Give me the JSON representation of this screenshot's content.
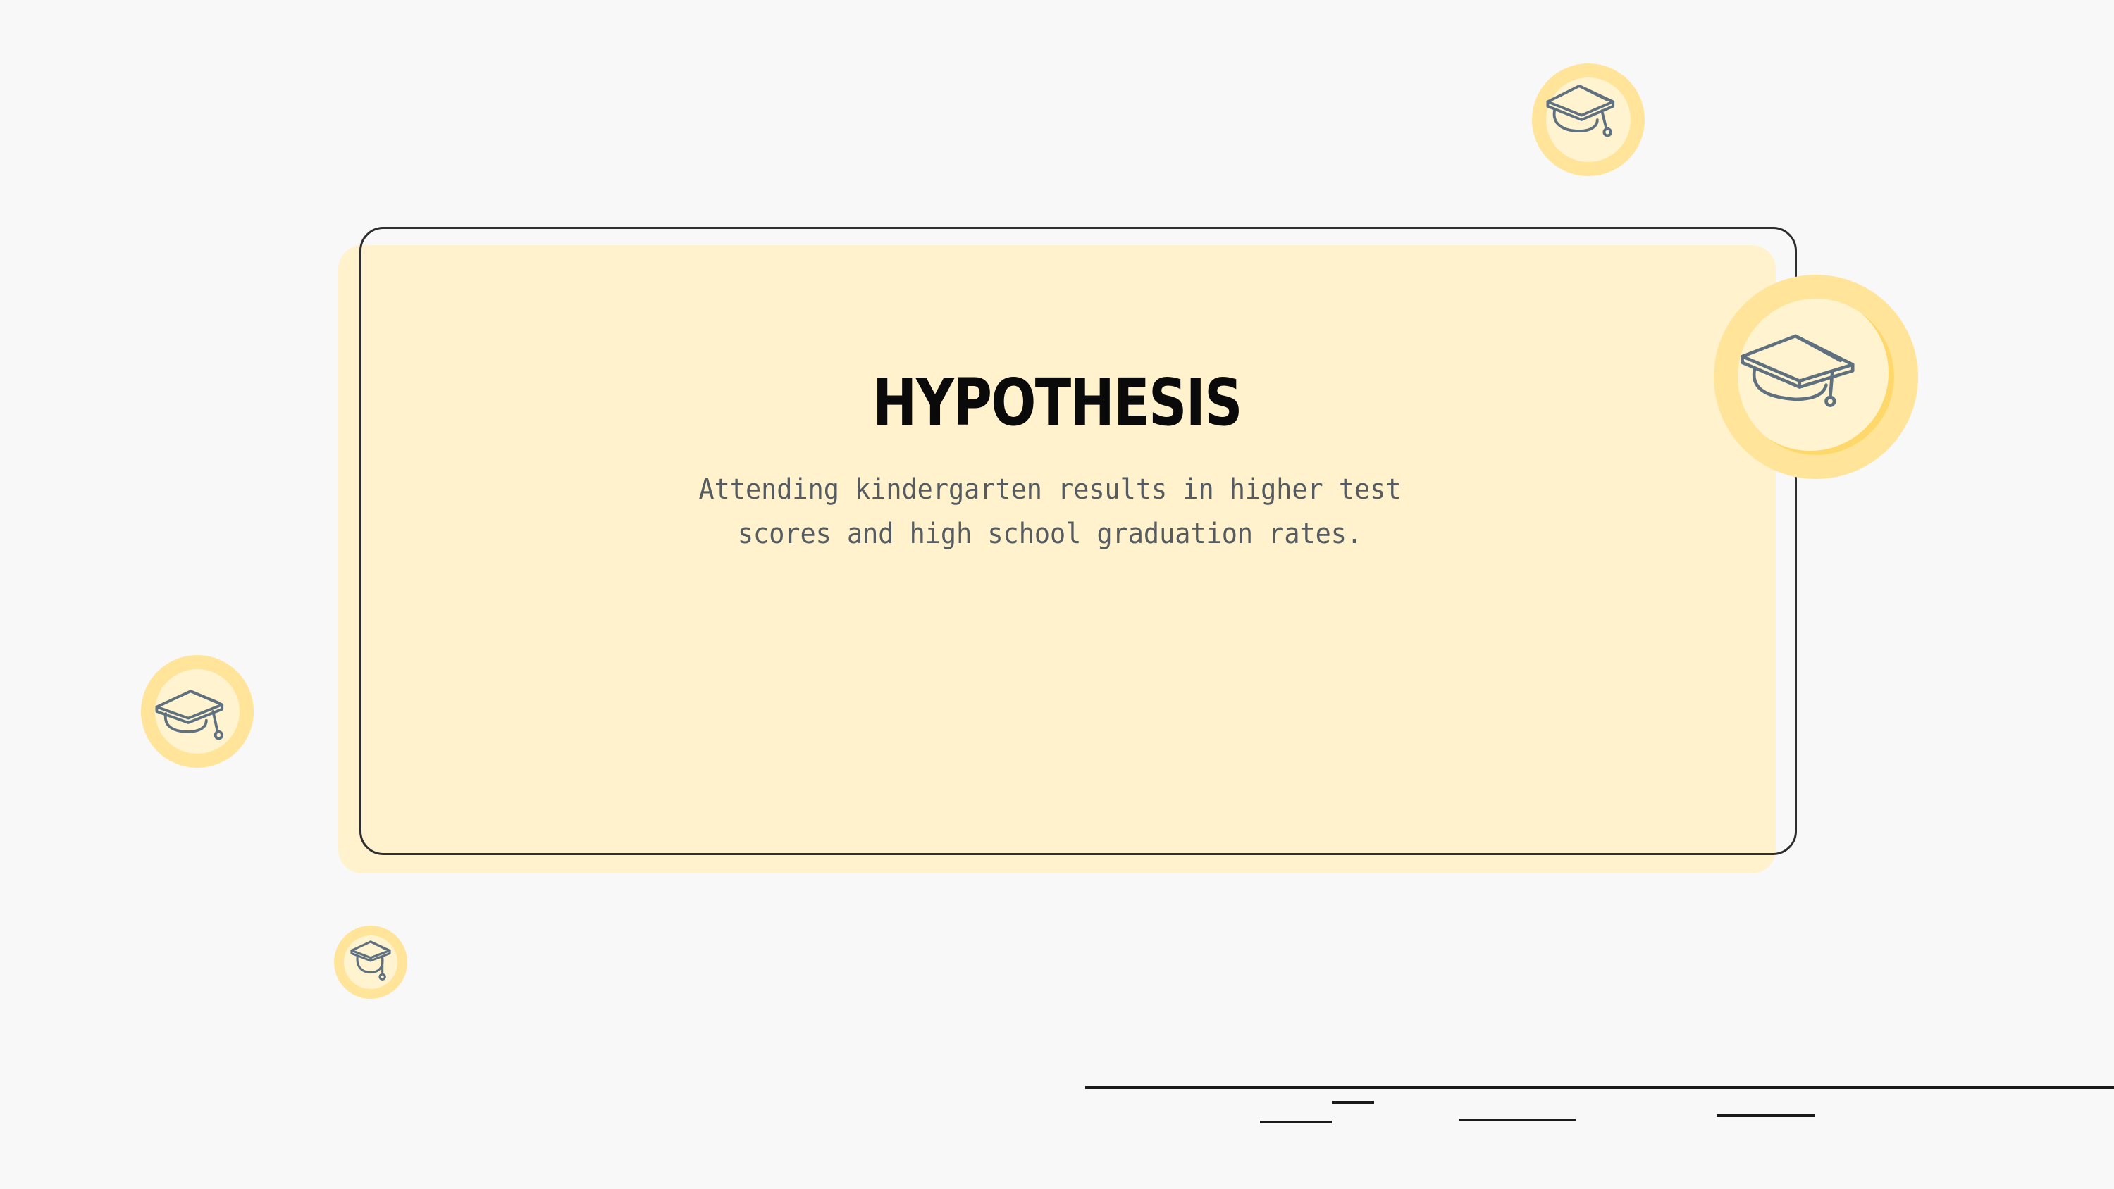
{
  "slide": {
    "title": "HYPOTHESIS",
    "body": "Attending kindergarten results in higher test scores and high school graduation rates."
  },
  "decorations": {
    "badge_icon": "graduation-cap-icon",
    "colors": {
      "background": "#f8f8f8",
      "card_fill": "#fff2cd",
      "badge_ring": "#ffe49a",
      "badge_inner": "#fff4cf",
      "icon_stroke": "#5f7180",
      "outline": "#2e2e2e"
    }
  }
}
